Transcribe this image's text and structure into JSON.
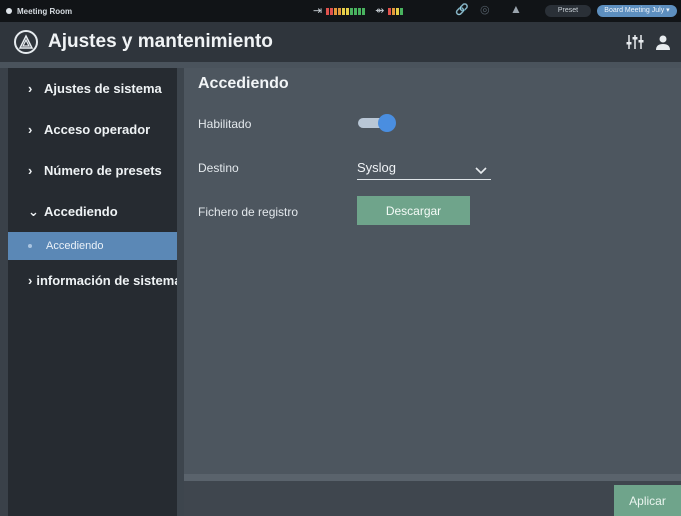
{
  "status_bar": {
    "room": "Meeting Room",
    "preset_label": "Preset",
    "preset_value": "Board Meeting July ▾"
  },
  "header": {
    "title": "Ajustes y mantenimiento"
  },
  "sidebar": {
    "items": [
      {
        "label": "Ajustes de sistema"
      },
      {
        "label": "Acceso operador"
      },
      {
        "label": "Número de presets"
      },
      {
        "label": "Accediendo"
      },
      {
        "label": "información de sistema"
      }
    ],
    "subitems": [
      {
        "label": "Accediendo"
      }
    ]
  },
  "main": {
    "section_title": "Accediendo",
    "enabled_label": "Habilitado",
    "enabled": true,
    "destination_label": "Destino",
    "destination_value": "Syslog",
    "log_file_label": "Fichero de registro",
    "download_label": "Descargar"
  },
  "footer": {
    "apply_label": "Aplicar"
  },
  "colors": {
    "accent_blue": "#5b88b6",
    "toggle_on": "#4a8ee0",
    "button_green": "#6fa48b",
    "meter_red": "#e0524d",
    "meter_orange": "#e39a3c",
    "meter_yellow": "#e6cf4a",
    "meter_green": "#49b35f"
  },
  "icons": {
    "input_meter": "input-arrow-icon",
    "output_meter": "output-arrow-icon",
    "link": "link-icon",
    "audio": "speaker-icon",
    "warning": "warning-icon",
    "logo": "audio-technica-logo-icon",
    "mixer": "mixer-sliders-icon",
    "user": "user-icon"
  }
}
